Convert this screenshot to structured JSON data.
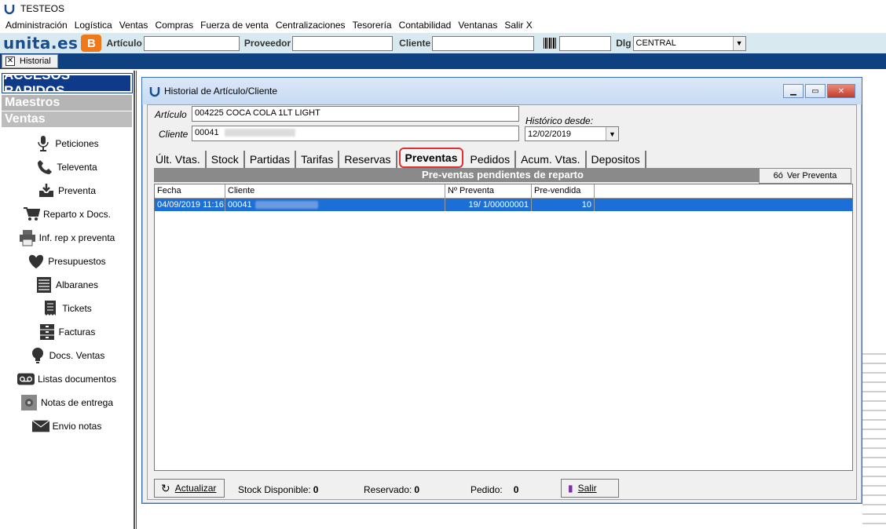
{
  "app_title": "TESTEOS",
  "menu": [
    "Administración",
    "Logística",
    "Ventas",
    "Compras",
    "Fuerza de venta",
    "Centralizaciones",
    "Tesorería",
    "Contabilidad",
    "Ventanas",
    "Salir X"
  ],
  "toolbar": {
    "brand": "unita.es",
    "articulo_label": "Artículo",
    "proveedor_label": "Proveedor",
    "cliente_label": "Cliente",
    "dlg_label": "Dlg",
    "dlg_value": "CENTRAL"
  },
  "open_tab": "Historial",
  "sidebar": {
    "header": "ACCESOS RAPIDOS",
    "sections": [
      "Maestros",
      "Ventas"
    ],
    "items": [
      {
        "label": "Peticiones",
        "icon": "microphone-icon"
      },
      {
        "label": "Televenta",
        "icon": "phone-icon"
      },
      {
        "label": "Preventa",
        "icon": "inbox-download-icon"
      },
      {
        "label": "Reparto x Docs.",
        "icon": "cart-icon"
      },
      {
        "label": "Inf. rep x preventa",
        "icon": "printer-icon"
      },
      {
        "label": "Presupuestos",
        "icon": "heart-icon"
      },
      {
        "label": "Albaranes",
        "icon": "list-icon"
      },
      {
        "label": "Tickets",
        "icon": "receipt-icon"
      },
      {
        "label": "Facturas",
        "icon": "file-cabinet-icon"
      },
      {
        "label": "Docs. Ventas",
        "icon": "lightbulb-icon"
      },
      {
        "label": "Listas documentos",
        "icon": "voicemail-icon"
      },
      {
        "label": "Notas de entrega",
        "icon": "safe-icon"
      },
      {
        "label": "Envio notas",
        "icon": "envelope-icon"
      }
    ]
  },
  "window": {
    "title": "Historial de Artículo/Cliente",
    "articulo_label": "Artículo",
    "articulo_value": "004225 COCA COLA 1LT LIGHT",
    "cliente_label": "Cliente",
    "cliente_value": "00041",
    "historico_label": "Histórico desde:",
    "historico_value": "12/02/2019",
    "tabs": [
      "Últ. Vtas.",
      "Stock",
      "Partidas",
      "Tarifas",
      "Reservas",
      "Preventas",
      "Pedidos",
      "Acum. Vtas.",
      "Depositos"
    ],
    "active_tab": "Preventas",
    "panel_header": "Pre-ventas pendientes de reparto",
    "ver_button": "Ver Preventa",
    "columns": [
      "Fecha",
      "Cliente",
      "Nº Preventa",
      "Pre-vendida"
    ],
    "rows": [
      {
        "fecha": "04/09/2019 11:16:",
        "cliente": "00041",
        "preventa": "19/  1/00000001",
        "prevendida": "10"
      }
    ],
    "actualizar": "Actualizar",
    "stock_label": "Stock Disponible:",
    "stock_value": "0",
    "reservado_label": "Reservado:",
    "reservado_value": "0",
    "pedido_label": "Pedido:",
    "pedido_value": "0",
    "salir": "Salir"
  }
}
